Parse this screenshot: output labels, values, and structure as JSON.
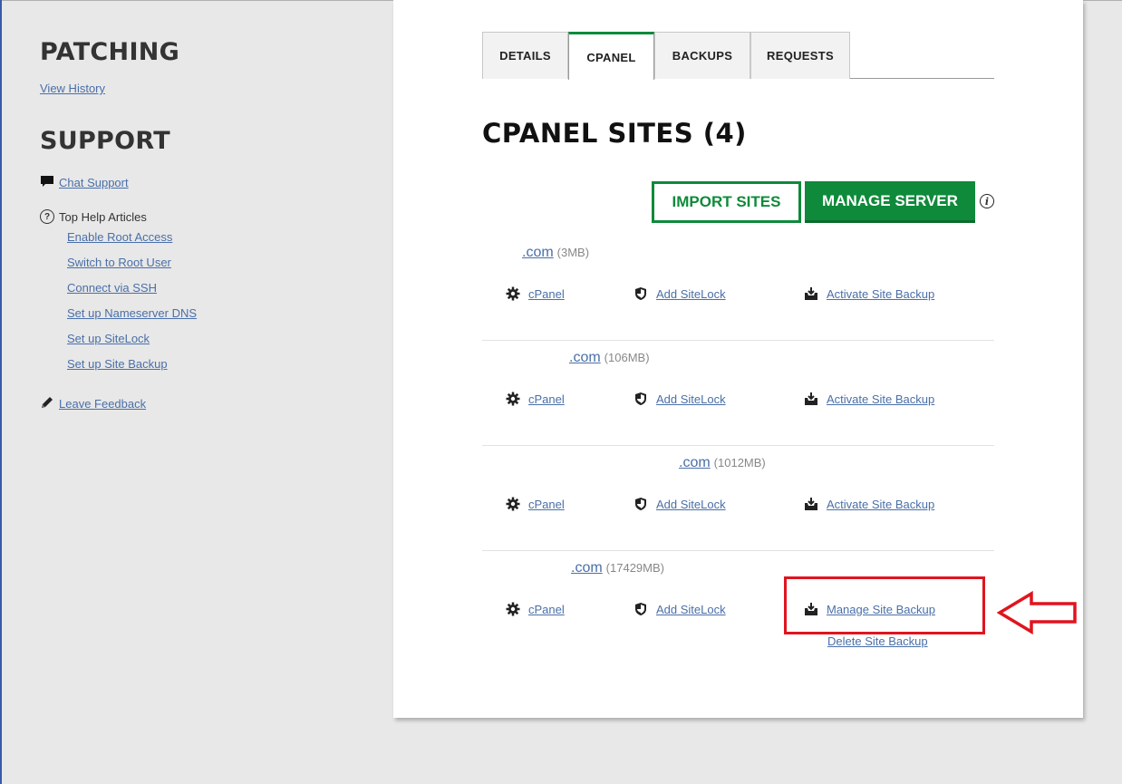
{
  "sidebar": {
    "patching_heading": "PATCHING",
    "view_history": "View History",
    "support_heading": "SUPPORT",
    "chat_support": "Chat Support",
    "top_help_title": "Top Help Articles",
    "help_articles": [
      "Enable Root Access",
      "Switch to Root User",
      "Connect via SSH",
      "Set up Nameserver DNS",
      "Set up SiteLock",
      "Set up Site Backup"
    ],
    "leave_feedback": "Leave Feedback"
  },
  "tabs": [
    "DETAILS",
    "CPANEL",
    "BACKUPS",
    "REQUESTS"
  ],
  "active_tab": "CPANEL",
  "title": "CPANEL SITES (4)",
  "buttons": {
    "import": "IMPORT SITES",
    "manage": "MANAGE SERVER"
  },
  "sites": [
    {
      "domain": ".com",
      "size": "(3MB)",
      "cpanel": "cPanel",
      "sitelock": "Add SiteLock",
      "backup": "Activate Site Backup"
    },
    {
      "domain": ".com",
      "size": "(106MB)",
      "cpanel": "cPanel",
      "sitelock": "Add SiteLock",
      "backup": "Activate Site Backup"
    },
    {
      "domain": ".com",
      "size": "(1012MB)",
      "cpanel": "cPanel",
      "sitelock": "Add SiteLock",
      "backup": "Activate Site Backup"
    },
    {
      "domain": ".com",
      "size": "(17429MB)",
      "cpanel": "cPanel",
      "sitelock": "Add SiteLock",
      "backup": "Manage Site Backup",
      "delete_backup": "Delete Site Backup"
    }
  ],
  "colors": {
    "accent_green": "#0e8a3a",
    "link_blue": "#4a6fa8",
    "annotation_red": "#e0141e"
  }
}
